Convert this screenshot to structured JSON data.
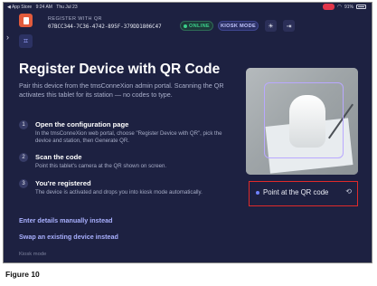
{
  "status_bar": {
    "carrier": "◀ App Store",
    "time": "9:24 AM",
    "date": "Thu Jul 23",
    "battery": "91%"
  },
  "header": {
    "register_label": "REGISTER WITH QR",
    "device_id": "07BCC344-7C36-4742-895F-379DD1806C47",
    "online_label": "ONLINE",
    "kiosk_label": "KIOSK MODE"
  },
  "main": {
    "title": "Register Device with QR Code",
    "intro": "Pair this device from the tmsConneXion admin portal. Scanning the QR activates this tablet for its station — no codes to type.",
    "steps": [
      {
        "num": "1",
        "title": "Open the configuration page",
        "desc": "In the tmsConneXion web portal, choose \"Register Device with QR\", pick the device and station, then Generate QR."
      },
      {
        "num": "2",
        "title": "Scan the code",
        "desc": "Point this tablet's camera at the QR shown on screen."
      },
      {
        "num": "3",
        "title": "You're registered",
        "desc": "The device is activated and drops you into kiosk mode automatically."
      }
    ],
    "links": {
      "manual": "Enter details manually instead",
      "swap": "Swap an existing device instead"
    },
    "footer": "Kiosk mode"
  },
  "camera": {
    "status": "Point at the QR code"
  },
  "caption": "Figure 10",
  "colors": {
    "background": "#1d2141",
    "accent": "#a9b0ff",
    "online": "#3ad08a",
    "highlight_border": "#e02a2a",
    "logo": "#e25b3c"
  },
  "icons": {
    "logo": "app-logo-icon",
    "qr": "qr-scan-icon",
    "theme": "sun-icon",
    "exit": "exit-icon",
    "switch_camera": "camera-switch-icon"
  }
}
